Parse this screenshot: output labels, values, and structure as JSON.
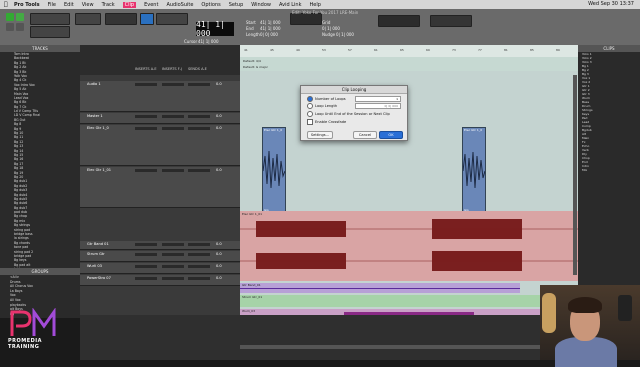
{
  "menubar": {
    "app": "Pro Tools",
    "items": [
      "File",
      "Edit",
      "View",
      "Track",
      "Clip",
      "Event",
      "AudioSuite",
      "Options",
      "Setup",
      "Window",
      "Avid Link",
      "Help"
    ],
    "active": "Clip",
    "clock": "Wed Sep 30 13:37"
  },
  "window": {
    "title": "Edit: Yoko For You 2017 LRE-Main"
  },
  "toolbar": {
    "counter": "41| 1| 000",
    "start_label": "Start",
    "end_label": "End",
    "length_label": "Length",
    "start": "41| 1| 000",
    "end": "41| 1| 000",
    "length": "0| 0| 000",
    "cursor_label": "Cursor",
    "cursor": "41| 1| 000",
    "nudge_label": "Nudge",
    "nudge": "0| 1| 000",
    "grid_label": "Grid",
    "grid": "0| 1| 000"
  },
  "left_panel": {
    "tracks_title": "TRACKS",
    "tracks": [
      "Tom Intro",
      "Backbeat",
      "Bg 1 Bt",
      "Bg 2 Ak",
      "Bg 3 Bk",
      "Yolk Vox",
      "Bg 4 Ck",
      "Vox Intro Vox",
      "Bg 5 Ak",
      "Main Vox",
      "Lead Vox",
      "Bg 6 Bk",
      "Bg 7 Ck",
      "Ld V Comp TKs",
      "LD V Comp Final",
      "BG Out",
      "Bg 8",
      "Bg 9",
      "Bg 10",
      "Bg 11",
      "Bg 12",
      "Bg 13",
      "Bg 14",
      "Bg 15",
      "Bg 16",
      "Bg 17",
      "Bg 18",
      "Bg 19",
      "Bg 20",
      "Bg dub1",
      "Bg dub2",
      "Bg dub3",
      "Bg dub4",
      "Bg dub5",
      "Bg dub6",
      "Bg dub7",
      "pad dub",
      "Bg chop",
      "Bg mix",
      "Bg strings",
      "string pad",
      "bridge bass",
      "la strings",
      "Bg chords",
      "tone pad",
      "string pad 2",
      "bridge pad",
      "Bg keys",
      "Bg pad alt",
      "bridge pa",
      "Bg end",
      "Bg end2"
    ],
    "groups_title": "GROUPS",
    "groups": [
      "<All>",
      "Drums",
      "All Chorus Vox",
      "La Boys",
      "Vox",
      "All Vox",
      "playbacks",
      "alt Boys",
      "Bg"
    ]
  },
  "logo": {
    "brand": "PROMEDIA TRAINING"
  },
  "mixer": {
    "headers": [
      "INSERTS A-E",
      "INSERTS F-J",
      "SENDS A-E"
    ],
    "tracks": [
      {
        "name": "Audio 1",
        "vol": "0.0"
      },
      {
        "name": "Master 1",
        "vol": "0.0"
      },
      {
        "name": "Elec Gtr 1_0",
        "vol": "0.0"
      },
      {
        "name": "Elec Gtr 1_01",
        "vol": "0.0"
      },
      {
        "name": "Gtr Band 01",
        "vol": "0.0"
      },
      {
        "name": "Strum Gtr",
        "vol": "0.0"
      },
      {
        "name": "Wurli 03",
        "vol": "0.0"
      },
      {
        "name": "PowerStro 07",
        "vol": "0.0"
      }
    ]
  },
  "timeline": {
    "ruler": [
      "41",
      "45",
      "49",
      "53",
      "57",
      "61",
      "65",
      "69",
      "73",
      "77",
      "81",
      "85",
      "89"
    ],
    "markers": [
      "Default: 4/4",
      "Default: G major"
    ],
    "clips": [
      {
        "title": "Elec Gtr 1_0",
        "foot": "GG"
      },
      {
        "title": "Elec Gtr 1_0",
        "foot": "GG"
      },
      {
        "title": "Elec Gtr 1_01",
        "foot": ""
      },
      {
        "title": "Gtr Band_01",
        "foot": ""
      },
      {
        "title": "Strum Gtr_01",
        "foot": ""
      },
      {
        "title": "Wurli_03",
        "foot": ""
      },
      {
        "title": "PowerStro_07",
        "foot": ""
      }
    ]
  },
  "dialog": {
    "title": "Clip Looping",
    "opt1": "Number of Loops",
    "opt1_value": "1",
    "opt2": "Loop Length",
    "opt2_value": "0| 0| 000",
    "opt3": "Loop Until End of the Session or Next Clip",
    "opt4": "Enable Crossfade",
    "settings": "Settings...",
    "cancel": "Cancel",
    "ok": "OK"
  },
  "clips_panel": {
    "title": "CLIPS",
    "items": [
      "Yoko 1",
      "Yoko 2",
      "Yoko 3",
      "Bg 1",
      "Bg 2",
      "Bg 3",
      "Vox 1",
      "Vox 2",
      "Gtr 1",
      "Gtr 2",
      "Gtr 3",
      "Wurli",
      "Bass",
      "Drum",
      "Strings",
      "Keys",
      "Pad",
      "Lead",
      "Comp",
      "Bgdub",
      "Alt",
      "Main",
      "Fx",
      "Echo",
      "Verb",
      "Dly",
      "Chop",
      "End",
      "Intro",
      "Mix"
    ]
  },
  "colors": {
    "accent": "#e8336e",
    "pink_track": "#d9a4a4",
    "purple_track": "#b7a0d6",
    "green_track": "#a6d3a8"
  }
}
